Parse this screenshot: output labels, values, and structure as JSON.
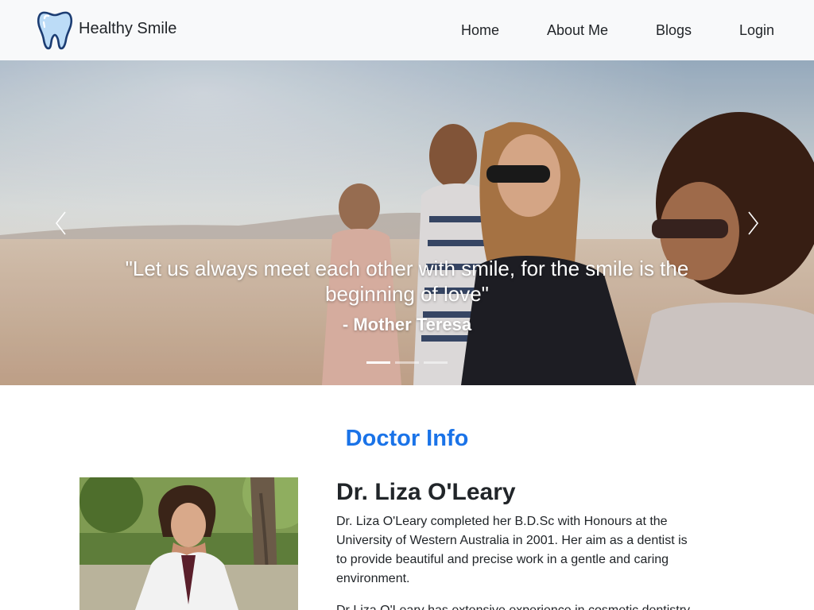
{
  "navbar": {
    "brand": "Healthy Smile",
    "logo_icon": "tooth-icon",
    "links": [
      "Home",
      "About Me",
      "Blogs",
      "Login"
    ]
  },
  "carousel": {
    "quote": "\"Let us always meet each other with smile, for the smile is the beginning of love\"",
    "author": "- Mother Teresa",
    "prev_icon": "chevron-left-icon",
    "next_icon": "chevron-right-icon",
    "slide_count": 3,
    "active_slide": 1
  },
  "doctor": {
    "section_title": "Doctor Info",
    "name": "Dr. Liza O'Leary",
    "bio": [
      "Dr. Liza O'Leary completed her B.D.Sc with Honours at the University of Western Australia in 2001. Her aim as a dentist is to provide beautiful and precise work in a gentle and caring environment.",
      "Dr Liza O'Leary has extensive experience in cosmetic dentistry"
    ]
  },
  "colors": {
    "accent": "#1a73e8",
    "navbar_bg": "#f8f9fa",
    "text": "#212529"
  }
}
